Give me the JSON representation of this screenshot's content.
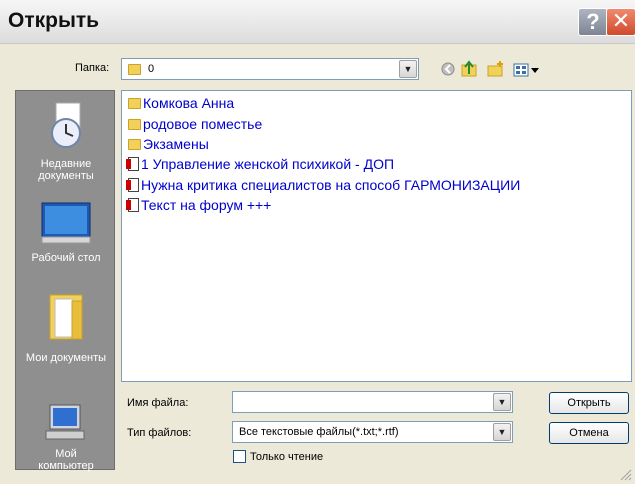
{
  "dialog": {
    "title": "Открыть",
    "help_symbol": "?",
    "close_symbol": "✕"
  },
  "location": {
    "label": "Папка:",
    "value": "0"
  },
  "places": [
    {
      "label_line1": "Недавние",
      "label_line2": "документы",
      "icon": "recent-documents-icon"
    },
    {
      "label_line1": "Рабочий стол",
      "label_line2": "",
      "icon": "desktop-icon"
    },
    {
      "label_line1": "Мои документы",
      "label_line2": "",
      "icon": "my-documents-icon"
    },
    {
      "label_line1": "Мой",
      "label_line2": "компьютер",
      "icon": "my-computer-icon"
    }
  ],
  "files": [
    {
      "name": "Комкова Анна",
      "type": "folder"
    },
    {
      "name": "родовое поместье",
      "type": "folder"
    },
    {
      "name": "Экзамены",
      "type": "folder"
    },
    {
      "name": "1 Управление женской психикой - ДОП",
      "type": "document"
    },
    {
      "name": "Нужна критика специалистов на способ ГАРМОНИЗАЦИИ",
      "type": "document"
    },
    {
      "name": "Текст на форум +++",
      "type": "document"
    }
  ],
  "filename": {
    "label": "Имя файла:",
    "value": ""
  },
  "filetype": {
    "label": "Тип файлов:",
    "value": "Все текстовые файлы(*.txt;*.rtf)"
  },
  "readonly": {
    "label": "Только чтение",
    "checked": false
  },
  "buttons": {
    "open": "Открыть",
    "cancel": "Отмена"
  },
  "colors": {
    "link": "#0000cc",
    "places_bg": "#8f8f8f",
    "dialog_bg": "#ECE9D8"
  }
}
